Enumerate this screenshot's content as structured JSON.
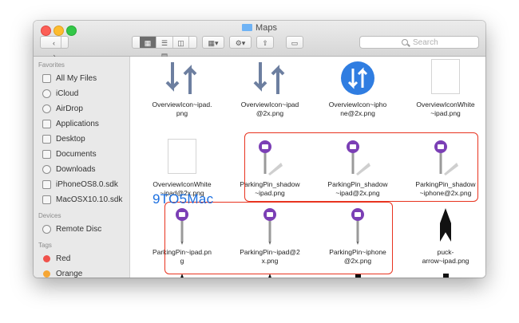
{
  "window": {
    "title": "Maps"
  },
  "toolbar": {
    "back_icon": "chevron-left-icon",
    "forward_icon": "chevron-right-icon",
    "view_modes": [
      "icon-view",
      "list-view",
      "column-view",
      "cover-flow-view"
    ],
    "arrange_icon": "arrange-grid-icon",
    "action_icon": "gear-icon",
    "share_icon": "share-icon",
    "tag_icon": "tag-icon"
  },
  "search": {
    "placeholder": "Search"
  },
  "sidebar": {
    "favorites_header": "Favorites",
    "favorites": [
      {
        "label": "All My Files",
        "icon": "all-files-icon"
      },
      {
        "label": "iCloud",
        "icon": "cloud-icon"
      },
      {
        "label": "AirDrop",
        "icon": "airdrop-icon"
      },
      {
        "label": "Applications",
        "icon": "applications-icon"
      },
      {
        "label": "Desktop",
        "icon": "desktop-icon"
      },
      {
        "label": "Documents",
        "icon": "documents-icon"
      },
      {
        "label": "Downloads",
        "icon": "downloads-icon"
      },
      {
        "label": "iPhoneOS8.0.sdk",
        "icon": "folder-icon"
      },
      {
        "label": "MacOSX10.10.sdk",
        "icon": "folder-icon"
      }
    ],
    "devices_header": "Devices",
    "devices": [
      {
        "label": "Remote Disc",
        "icon": "disc-icon"
      }
    ],
    "tags_header": "Tags",
    "tags": [
      {
        "label": "Red",
        "color": "#f0524c"
      },
      {
        "label": "Orange",
        "color": "#f6a634"
      }
    ]
  },
  "files": [
    {
      "name": "OverviewIcon~ipad.\npng",
      "icon": "gray-overview-icon"
    },
    {
      "name": "OverviewIcon~ipad\n@2x.png",
      "icon": "gray-overview-icon"
    },
    {
      "name": "OverviewIcon~ipho\nne@2x.png",
      "icon": "blue-overview-icon"
    },
    {
      "name": "OverviewIconWhite\n~ipad.png",
      "icon": "blank-image-icon"
    },
    {
      "name": "OverviewIconWhite\n~ipad@2x.png",
      "icon": "blank-image-icon"
    },
    {
      "name": "ParkingPin_shadow\n~ipad.png",
      "icon": "parking-pin-shadow-icon"
    },
    {
      "name": "ParkingPin_shadow\n~ipad@2x.png",
      "icon": "parking-pin-shadow-icon"
    },
    {
      "name": "ParkingPin_shadow\n~iphone@2x.png",
      "icon": "parking-pin-shadow-icon"
    },
    {
      "name": "ParkingPin~ipad.pn\ng",
      "icon": "parking-pin-icon"
    },
    {
      "name": "ParkingPin~ipad@2\nx.png",
      "icon": "parking-pin-icon"
    },
    {
      "name": "ParkingPin~iphone\n@2x.png",
      "icon": "parking-pin-icon"
    },
    {
      "name": "puck-\narrow~ipad.png",
      "icon": "puck-arrow-icon"
    },
    {
      "name": "",
      "icon": "puck-arrow-icon"
    },
    {
      "name": "",
      "icon": "puck-arrow-icon"
    },
    {
      "name": "",
      "icon": "pedestrian-icon"
    },
    {
      "name": "",
      "icon": "pedestrian-icon"
    }
  ],
  "watermark": "9TO5Mac",
  "colors": {
    "accent_blue": "#2f7de1",
    "pin_purple": "#7b3fb5",
    "highlight_red": "#e8331f"
  }
}
